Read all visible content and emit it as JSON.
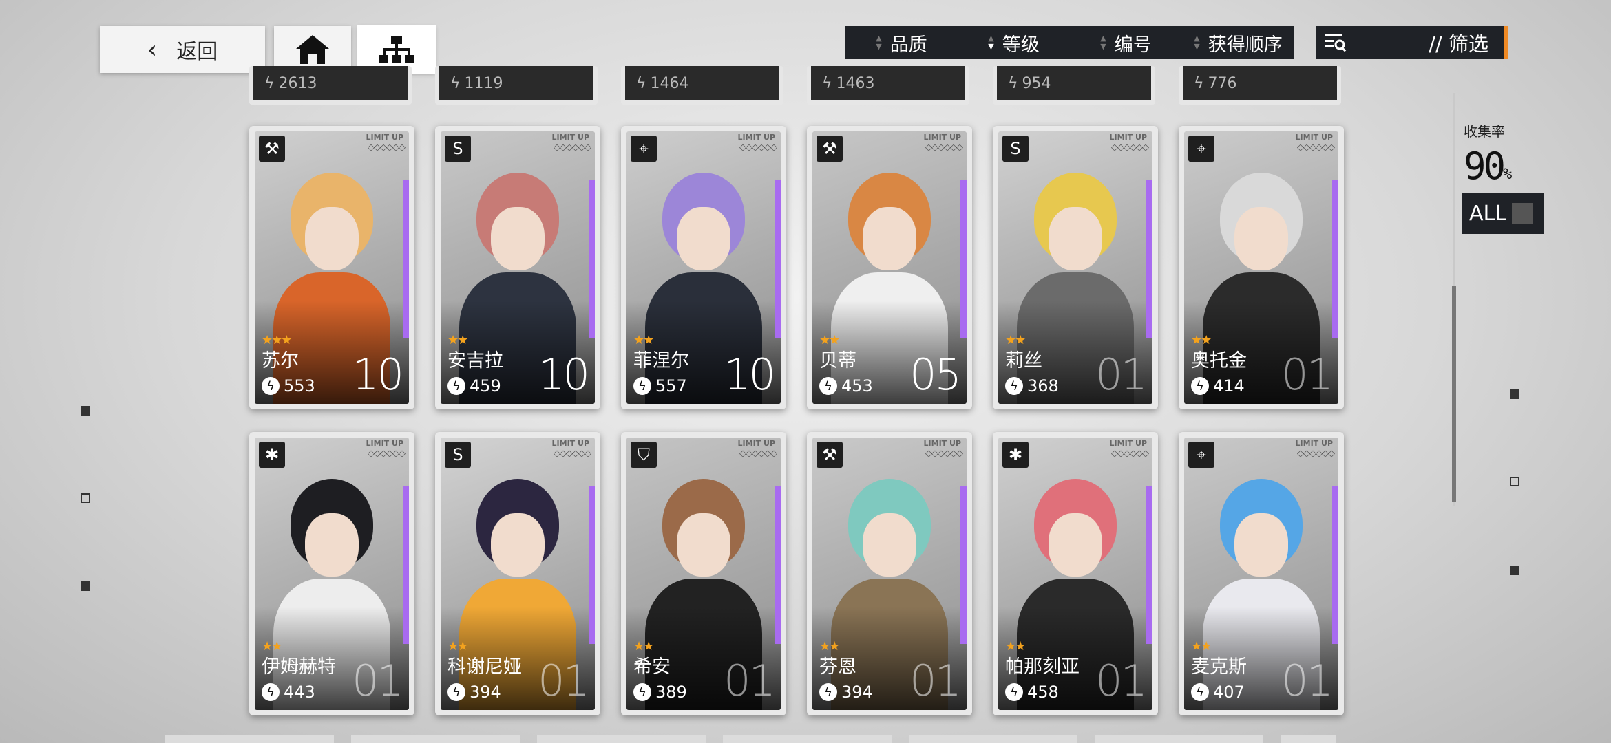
{
  "nav": {
    "back_label": "返回",
    "back_icon": "chevron-left-icon",
    "home_icon": "home-icon",
    "tree_icon": "hierarchy-icon"
  },
  "sort": {
    "items": [
      {
        "label": "品质",
        "active": false
      },
      {
        "label": "等级",
        "active": true
      },
      {
        "label": "编号",
        "active": false
      },
      {
        "label": "获得顺序",
        "active": false
      }
    ]
  },
  "filter": {
    "icon": "filter-list-icon",
    "label": "// 筛选"
  },
  "collection": {
    "label": "收集率",
    "rate": "90",
    "unit": "%",
    "all_label": "ALL"
  },
  "partial_row": [
    "2613",
    "1119",
    "1464",
    "1463",
    "954",
    "776"
  ],
  "cards": [
    {
      "name": "苏尔",
      "power": "553",
      "level": "10",
      "stars": "★★★",
      "class_icon": "hammer-icon",
      "limit": "LIMIT UP",
      "colors": {
        "hair": "#e9b46a",
        "body": "#d9652a",
        "bg": "#cfcfcf"
      }
    },
    {
      "name": "安吉拉",
      "power": "459",
      "level": "10",
      "stars": "★★",
      "class_icon": "shield-s-icon",
      "limit": "LIMIT UP",
      "colors": {
        "hair": "#c77b76",
        "body": "#2d3340",
        "bg": "#c8c8c8"
      }
    },
    {
      "name": "菲涅尔",
      "power": "557",
      "level": "10",
      "stars": "★★",
      "class_icon": "crosshair-icon",
      "limit": "LIMIT UP",
      "colors": {
        "hair": "#9c86d8",
        "body": "#2a2f3a",
        "bg": "#cdcdcd"
      }
    },
    {
      "name": "贝蒂",
      "power": "453",
      "level": "05",
      "stars": "★★",
      "class_icon": "hammer-icon",
      "limit": "LIMIT UP",
      "colors": {
        "hair": "#d98744",
        "body": "#efefef",
        "bg": "#c6c6c6"
      }
    },
    {
      "name": "莉丝",
      "power": "368",
      "level": "01",
      "stars": "★★",
      "class_icon": "shield-s-icon",
      "limit": "LIMIT UP",
      "colors": {
        "hair": "#e7c84f",
        "body": "#6b6b6b",
        "bg": "#d1d1d1"
      }
    },
    {
      "name": "奥托金",
      "power": "414",
      "level": "01",
      "stars": "★★",
      "class_icon": "crosshair-icon",
      "limit": "LIMIT UP",
      "colors": {
        "hair": "#d9d9d9",
        "body": "#2b2b2b",
        "bg": "#cbcbcb"
      }
    },
    {
      "name": "伊姆赫特",
      "power": "443",
      "level": "01",
      "stars": "★★",
      "class_icon": "asterisk-icon",
      "limit": "LIMIT UP",
      "colors": {
        "hair": "#1e1e22",
        "body": "#ededed",
        "bg": "#cfcfcf"
      }
    },
    {
      "name": "科谢尼娅",
      "power": "394",
      "level": "01",
      "stars": "★★",
      "class_icon": "shield-s-icon",
      "limit": "LIMIT UP",
      "colors": {
        "hair": "#2c2640",
        "body": "#f0a836",
        "bg": "#d3d3d3"
      }
    },
    {
      "name": "希安",
      "power": "389",
      "level": "01",
      "stars": "★★",
      "class_icon": "shield-badge-icon",
      "limit": "LIMIT UP",
      "colors": {
        "hair": "#9b6a49",
        "body": "#222222",
        "bg": "#c4c4c4"
      }
    },
    {
      "name": "芬恩",
      "power": "394",
      "level": "01",
      "stars": "★★",
      "class_icon": "hammer-icon",
      "limit": "LIMIT UP",
      "colors": {
        "hair": "#7fc9bf",
        "body": "#8a7455",
        "bg": "#c9c9c9"
      }
    },
    {
      "name": "帕那刻亚",
      "power": "458",
      "level": "01",
      "stars": "★★",
      "class_icon": "asterisk-icon",
      "limit": "LIMIT UP",
      "colors": {
        "hair": "#e0707a",
        "body": "#2a2a2a",
        "bg": "#d0d0d0"
      }
    },
    {
      "name": "麦克斯",
      "power": "407",
      "level": "01",
      "stars": "★★",
      "class_icon": "crosshair-icon",
      "limit": "LIMIT UP",
      "colors": {
        "hair": "#55a6e6",
        "body": "#e9e9ee",
        "bg": "#c9c9c9"
      }
    }
  ]
}
